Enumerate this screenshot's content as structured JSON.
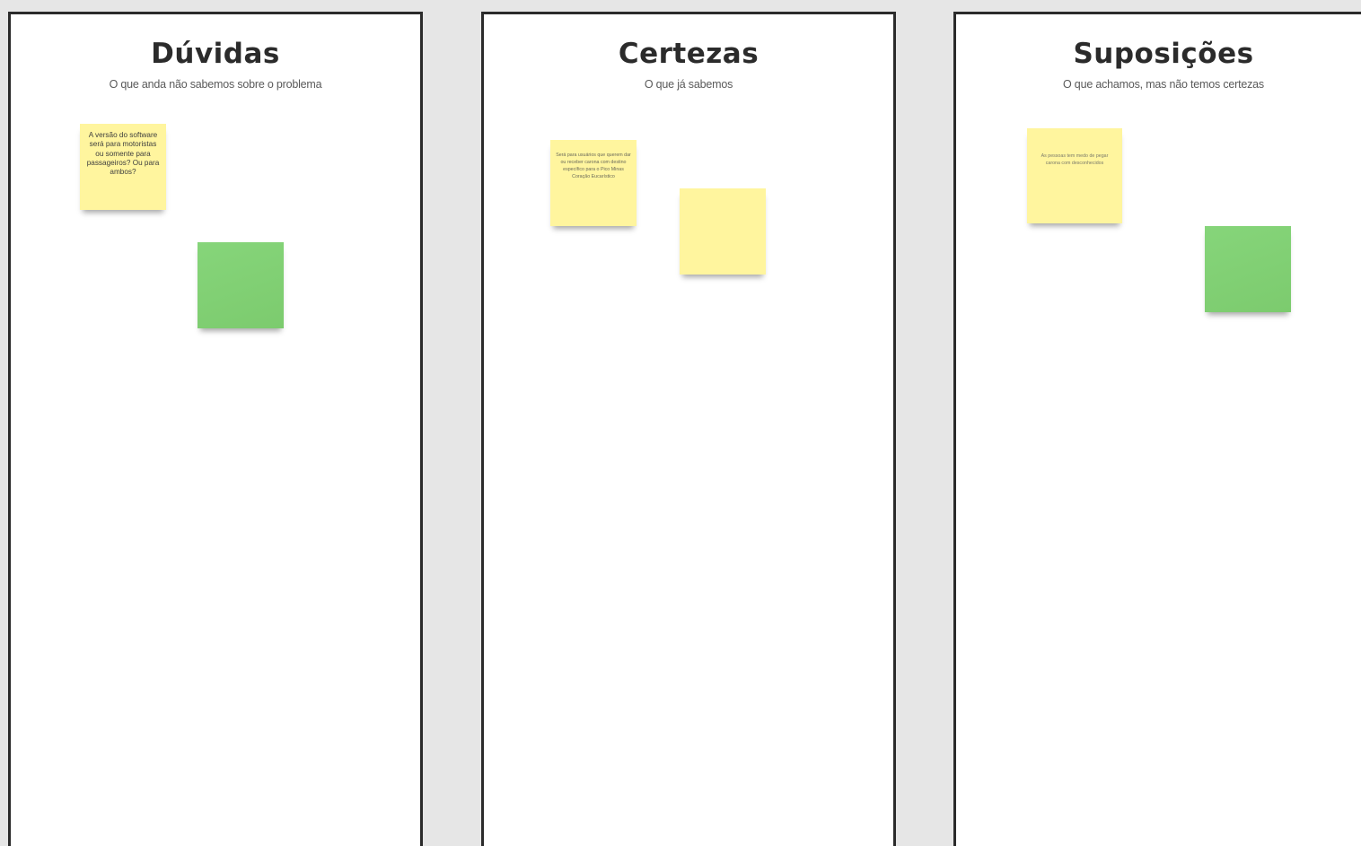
{
  "columns": [
    {
      "title": "Dúvidas",
      "subtitle": "O que anda não sabemos sobre o problema",
      "notes": [
        {
          "color": "yellow",
          "text": "A versão do software será para motoristas ou somente para passageiros? Ou para ambos?"
        },
        {
          "color": "green",
          "text": ""
        }
      ]
    },
    {
      "title": "Certezas",
      "subtitle": "O que já sabemos",
      "notes": [
        {
          "color": "yellow",
          "text": "Será para usuários que querem dar ou receber carona com destino específico para o Pico Minas Coração Eucarístico"
        },
        {
          "color": "yellow",
          "text": ""
        }
      ]
    },
    {
      "title": "Suposições",
      "subtitle": "O que achamos, mas não temos certezas",
      "notes": [
        {
          "color": "yellow",
          "text": "As pessoas tem medo de pegar carona com desconhecidos"
        },
        {
          "color": "green",
          "text": ""
        }
      ]
    }
  ],
  "colors": {
    "background": "#e6e6e6",
    "column": "#ffffff",
    "border": "#2b2b2b",
    "sticky_yellow": "#fff59e",
    "sticky_green": "#7ccb6e"
  }
}
